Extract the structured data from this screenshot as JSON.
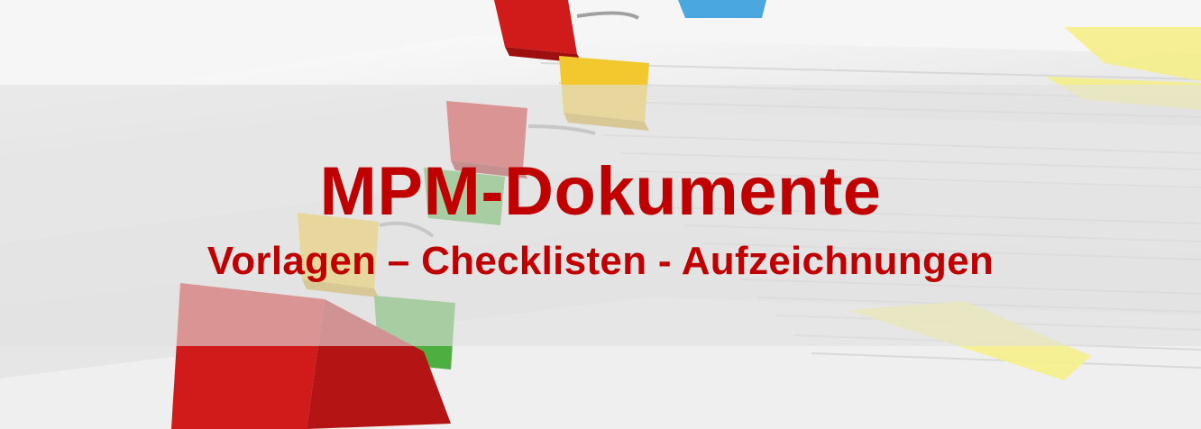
{
  "banner": {
    "title": "MPM-Dokumente",
    "subtitle": "Vorlagen – Checklisten - Aufzeichnungen",
    "image_description_icon": "paper-stack-with-binder-clips-image",
    "colors": {
      "text": "#c00000",
      "overlay": "rgba(225,225,225,0.62)",
      "clip_red": "#d11a1a",
      "clip_yellow": "#f2c82e",
      "clip_green": "#4caf3f",
      "clip_blue": "#4aa7e0",
      "tab_yellow": "#f6ef8a"
    }
  }
}
